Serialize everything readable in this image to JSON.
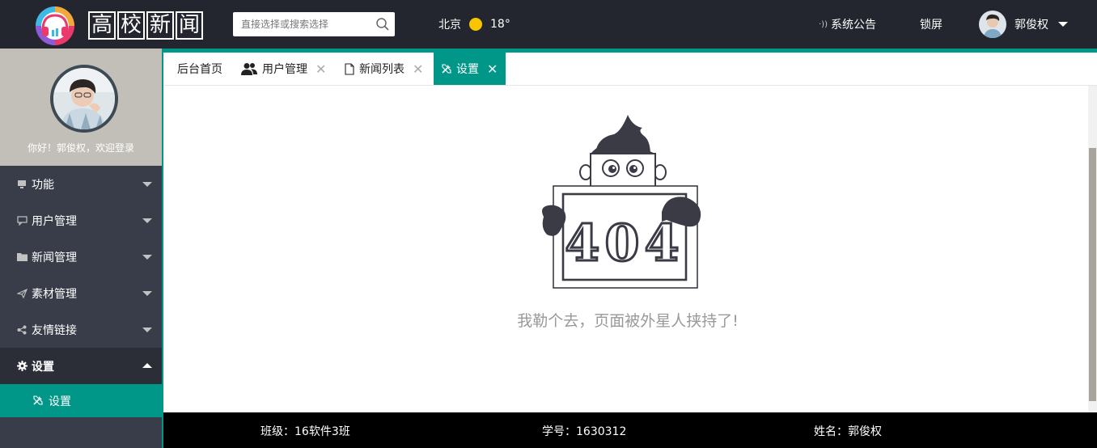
{
  "header": {
    "logo_text": [
      "高",
      "校",
      "新",
      "闻"
    ],
    "search_placeholder": "直接选择或搜索选择",
    "weather": {
      "city": "北京",
      "temp": "18°",
      "icon": "sun-icon"
    },
    "notice_label": "系统公告",
    "lock_label": "锁屏",
    "user_name": "郭俊权"
  },
  "sidebar": {
    "welcome": "你好！郭俊权，欢迎登录",
    "items": [
      {
        "label": "功能",
        "icon": "monitor-icon"
      },
      {
        "label": "用户管理",
        "icon": "chat-icon"
      },
      {
        "label": "新闻管理",
        "icon": "folder-icon"
      },
      {
        "label": "素材管理",
        "icon": "paper-plane-icon"
      },
      {
        "label": "友情链接",
        "icon": "share-icon"
      },
      {
        "label": "设置",
        "icon": "gear-icon"
      }
    ],
    "sub_item": {
      "label": "设置",
      "icon": "tools-icon"
    }
  },
  "tabs": [
    {
      "label": "后台首页"
    },
    {
      "label": "用户管理",
      "icon": "users-icon"
    },
    {
      "label": "新闻列表",
      "icon": "document-icon"
    },
    {
      "label": "设置",
      "icon": "tools-icon"
    }
  ],
  "content": {
    "illustration_text": "404",
    "message": "我勒个去，页面被外星人挟持了!"
  },
  "footer": {
    "class": "班级：16软件3班",
    "student_id": "学号：1630312",
    "name": "姓名：郭俊权"
  },
  "colors": {
    "accent": "#009688",
    "header_bg": "#23262e",
    "sidebar_bg": "#393d49",
    "sidebar_top_bg": "#c2bfb9"
  }
}
